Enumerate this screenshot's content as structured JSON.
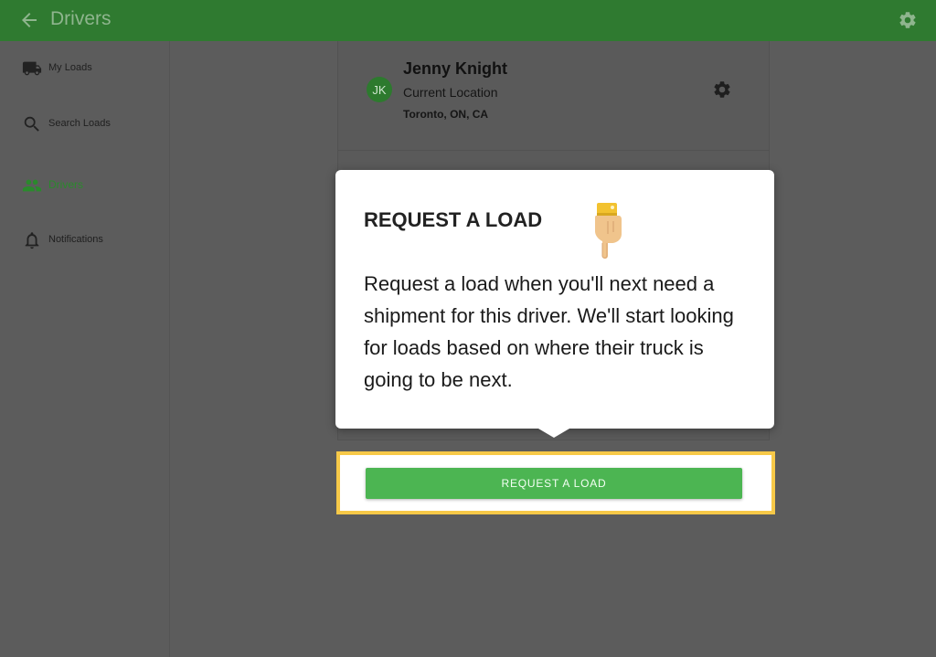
{
  "header": {
    "title": "Drivers",
    "back_icon": "arrow-left-icon",
    "settings_icon": "gear-icon"
  },
  "sidebar": {
    "items": [
      {
        "label": "My Loads",
        "icon": "truck-icon"
      },
      {
        "label": "Search Loads",
        "icon": "search-icon"
      },
      {
        "label": "Drivers",
        "icon": "people-icon",
        "active": true
      },
      {
        "label": "Notifications",
        "icon": "bell-icon"
      }
    ]
  },
  "driver_card": {
    "initials": "JK",
    "name": "Jenny Knight",
    "location_label": "Current Location",
    "location_value": "Toronto, ON, CA"
  },
  "tooltip": {
    "title": "REQUEST A LOAD",
    "body": "Request a load when you'll next need a shipment for this driver. We'll start looking for loads based on where their truck is going to be next.",
    "emoji_icon": "pointing-down-hand-icon"
  },
  "action": {
    "button_label": "REQUEST A LOAD"
  },
  "colors": {
    "header": "#2f7a30",
    "accent": "#4cb552",
    "highlight": "#f7c948",
    "overlay": "#5c5c5c"
  }
}
